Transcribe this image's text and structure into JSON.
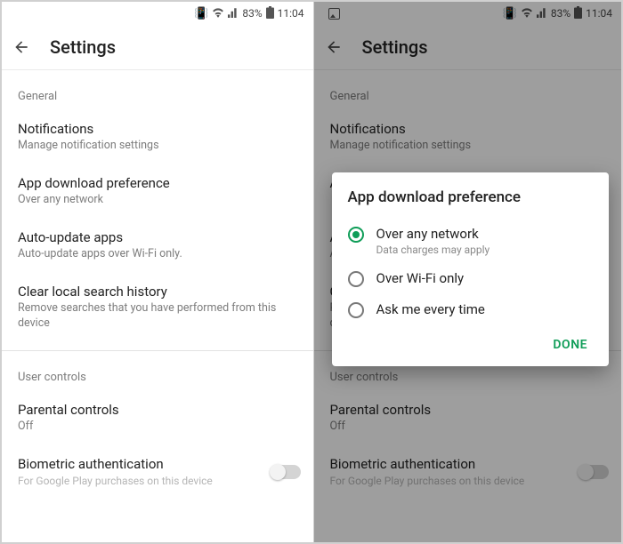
{
  "status": {
    "battery_pct": "83%",
    "time": "11:04"
  },
  "header": {
    "title": "Settings"
  },
  "sections": {
    "general_label": "General",
    "user_controls_label": "User controls"
  },
  "items": {
    "notifications": {
      "title": "Notifications",
      "sub": "Manage notification settings"
    },
    "download_pref": {
      "title": "App download preference",
      "sub": "Over any network",
      "title_short": "App"
    },
    "auto_update": {
      "title": "Auto-update apps",
      "sub": "Auto-update apps over Wi-Fi only.",
      "title_short": "Aut",
      "sub_short": "Auto"
    },
    "clear_history": {
      "title": "Clear local search history",
      "sub": "Remove searches that you have performed from this device",
      "title_short": "Clea",
      "sub_short_a": "Rem",
      "sub_short_b": "devi",
      "sub_short_tail": "this"
    },
    "parental": {
      "title": "Parental controls",
      "sub": "Off"
    },
    "biometric": {
      "title": "Biometric authentication",
      "sub": "For Google Play purchases on this device"
    }
  },
  "dialog": {
    "title": "App download preference",
    "options": [
      {
        "label": "Over any network",
        "sub": "Data charges may apply",
        "checked": true
      },
      {
        "label": "Over Wi-Fi only",
        "checked": false
      },
      {
        "label": "Ask me every time",
        "checked": false
      }
    ],
    "done": "DONE"
  }
}
